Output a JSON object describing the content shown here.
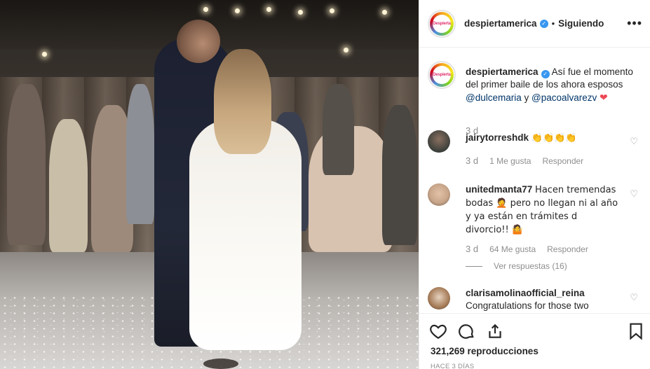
{
  "post": {
    "author": "despiertamerica",
    "avatar_text": "Despierta",
    "follow_status": "Siguiendo",
    "separator": "•",
    "more_label": "•••",
    "caption": {
      "text": "Así fue el momento del primer baile de los ahora esposos",
      "mentions": [
        "@dulcemaria",
        "@pacoalvarezv"
      ],
      "conjunction": "y",
      "emoji": "❤",
      "time": "3 d"
    },
    "comments": [
      {
        "user": "jairytorreshdk",
        "text": "👏👏👏👏",
        "time": "3 d",
        "likes": "1 Me gusta",
        "reply_label": "Responder",
        "avatar_color": "#3b3f3a"
      },
      {
        "user": "unitedmanta77",
        "text": "Hacen tremendas bodas 🤦 pero no llegan ni al año y ya están en trámites d divorcio!! 🤷",
        "time": "3 d",
        "likes": "64 Me gusta",
        "reply_label": "Responder",
        "view_replies": "Ver respuestas (16)",
        "avatar_color": "#c9a68a"
      },
      {
        "user": "clarisamolinaofficial_reina",
        "text": "Congratulations for those two",
        "avatar_color": "#a67c58"
      }
    ],
    "stats": {
      "views": "321,269 reproducciones",
      "date": "HACE 3 DÍAS"
    },
    "icons": {
      "like": "heart-icon",
      "comment": "comment-icon",
      "share": "share-icon",
      "save": "bookmark-icon",
      "verified": "verified-badge-icon",
      "small_like": "heart-outline-icon"
    },
    "colors": {
      "text": "#262626",
      "muted": "#8e8e8e",
      "verified": "#3897f0",
      "mention": "#003569",
      "heart": "#ed4956"
    }
  }
}
